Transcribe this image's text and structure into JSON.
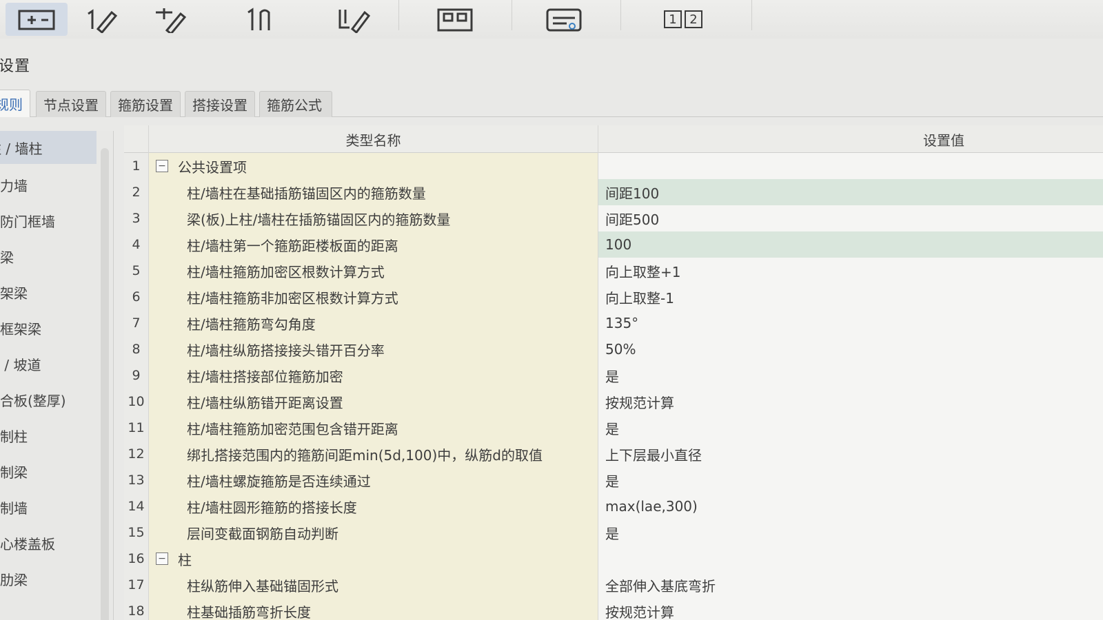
{
  "toolbar": {
    "icons": [
      "add-layer-icon",
      "edit-1-icon",
      "add-edit-icon",
      "vertical-lines-icon",
      "draw-edit-icon",
      "layout-grid-icon",
      "list-settings-icon",
      "numbered-tiles-icon"
    ],
    "numbered_tile_1": "1",
    "numbered_tile_2": "2"
  },
  "page": {
    "title": "设置"
  },
  "tabs": [
    {
      "label": "规则",
      "active": true
    },
    {
      "label": "节点设置",
      "active": false
    },
    {
      "label": "箍筋设置",
      "active": false
    },
    {
      "label": "搭接设置",
      "active": false
    },
    {
      "label": "箍筋公式",
      "active": false
    }
  ],
  "sidebar": {
    "items": [
      {
        "label": "柱 / 墙柱",
        "selected": true
      },
      {
        "label": "剪力墙"
      },
      {
        "label": "人防门框墙"
      },
      {
        "label": "连梁"
      },
      {
        "label": "框架梁"
      },
      {
        "label": "非框架梁"
      },
      {
        "label": "板 / 坡道"
      },
      {
        "label": "叠合板(整厚)"
      },
      {
        "label": "预制柱"
      },
      {
        "label": "预制梁"
      },
      {
        "label": "预制墙"
      },
      {
        "label": "空心楼盖板"
      },
      {
        "label": "主肋梁"
      }
    ]
  },
  "grid": {
    "header": {
      "name": "类型名称",
      "value": "设置值"
    },
    "rows": [
      {
        "num": "1",
        "name": "公共设置项",
        "value": "",
        "group": true,
        "toggle": "−"
      },
      {
        "num": "2",
        "name": "柱/墙柱在基础插筋锚固区内的箍筋数量",
        "value": "间距100",
        "highlight": true
      },
      {
        "num": "3",
        "name": "梁(板)上柱/墙柱在插筋锚固区内的箍筋数量",
        "value": "间距500"
      },
      {
        "num": "4",
        "name": "柱/墙柱第一个箍筋距楼板面的距离",
        "value": "100",
        "highlight": true
      },
      {
        "num": "5",
        "name": "柱/墙柱箍筋加密区根数计算方式",
        "value": "向上取整+1"
      },
      {
        "num": "6",
        "name": "柱/墙柱箍筋非加密区根数计算方式",
        "value": "向上取整-1"
      },
      {
        "num": "7",
        "name": "柱/墙柱箍筋弯勾角度",
        "value": "135°"
      },
      {
        "num": "8",
        "name": "柱/墙柱纵筋搭接接头错开百分率",
        "value": "50%"
      },
      {
        "num": "9",
        "name": "柱/墙柱搭接部位箍筋加密",
        "value": "是"
      },
      {
        "num": "10",
        "name": "柱/墙柱纵筋错开距离设置",
        "value": "按规范计算"
      },
      {
        "num": "11",
        "name": "柱/墙柱箍筋加密范围包含错开距离",
        "value": "是"
      },
      {
        "num": "12",
        "name": "绑扎搭接范围内的箍筋间距min(5d,100)中，纵筋d的取值",
        "value": "上下层最小直径"
      },
      {
        "num": "13",
        "name": "柱/墙柱螺旋箍筋是否连续通过",
        "value": "是"
      },
      {
        "num": "14",
        "name": "柱/墙柱圆形箍筋的搭接长度",
        "value": "max(lae,300)"
      },
      {
        "num": "15",
        "name": "层间变截面钢筋自动判断",
        "value": "是"
      },
      {
        "num": "16",
        "name": "柱",
        "value": "",
        "group": true,
        "toggle": "−"
      },
      {
        "num": "17",
        "name": "柱纵筋伸入基础锚固形式",
        "value": "全部伸入基底弯折"
      },
      {
        "num": "18",
        "name": "柱基础插筋弯折长度",
        "value": "按规范计算"
      }
    ]
  }
}
